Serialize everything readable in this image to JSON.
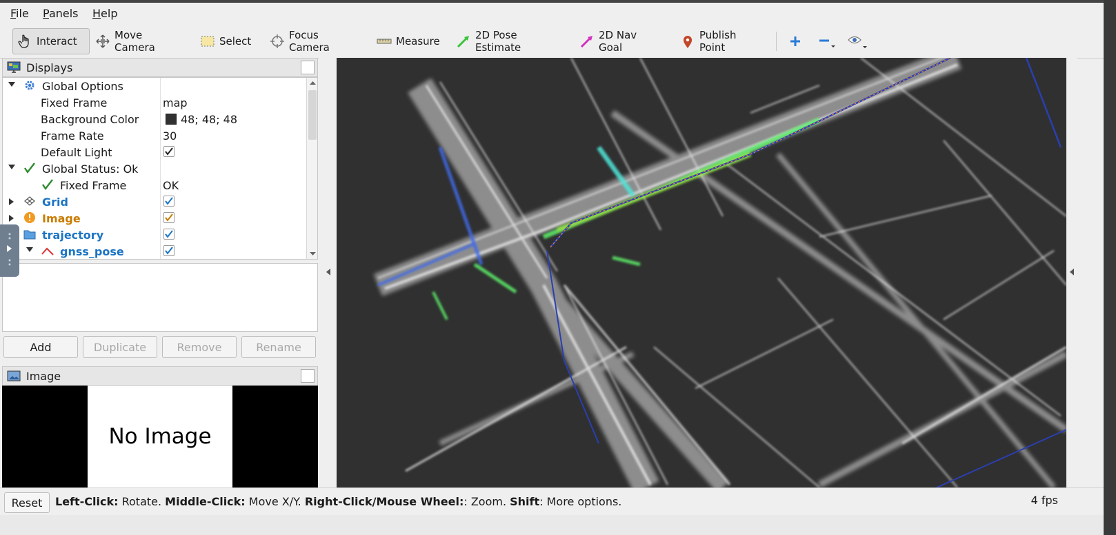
{
  "menu": [
    "File",
    "Panels",
    "Help"
  ],
  "toolbar": {
    "tools": [
      {
        "label": "Interact",
        "icon": "hand-pointer-icon",
        "active": true
      },
      {
        "label": "Move Camera",
        "icon": "move-camera-icon"
      },
      {
        "label": "Select",
        "icon": "select-box-icon"
      },
      {
        "label": "Focus Camera",
        "icon": "focus-crosshair-icon"
      },
      {
        "label": "Measure",
        "icon": "ruler-icon"
      },
      {
        "label": "2D Pose Estimate",
        "icon": "green-arrow-icon"
      },
      {
        "label": "2D Nav Goal",
        "icon": "magenta-arrow-icon"
      },
      {
        "label": "Publish Point",
        "icon": "map-pin-icon"
      }
    ],
    "extra_icons": [
      "plus-icon",
      "minus-icon",
      "eye-icon"
    ]
  },
  "displays_panel": {
    "title": "Displays",
    "tree": {
      "global_options": "Global Options",
      "fixed_frame_label": "Fixed Frame",
      "fixed_frame_value": "map",
      "bg_color_label": "Background Color",
      "bg_color_value": "48; 48; 48",
      "bg_color_swatch": "#303030",
      "frame_rate_label": "Frame Rate",
      "frame_rate_value": "30",
      "default_light_label": "Default Light",
      "default_light_checked": true,
      "global_status": "Global Status: Ok",
      "status_fixed_frame": "Fixed Frame",
      "status_fixed_frame_value": "OK",
      "grid": "Grid",
      "image": "Image",
      "trajectory": "trajectory",
      "gnss_pose": "gnss_pose"
    },
    "buttons": {
      "add": "Add",
      "duplicate": "Duplicate",
      "remove": "Remove",
      "rename": "Rename"
    }
  },
  "image_panel": {
    "title": "Image",
    "placeholder": "No Image"
  },
  "status_bar": {
    "reset": "Reset",
    "hint_parts": [
      {
        "text": "Left-Click:",
        "bold": true
      },
      {
        "text": " Rotate. ",
        "bold": false
      },
      {
        "text": "Middle-Click:",
        "bold": true
      },
      {
        "text": " Move X/Y. ",
        "bold": false
      },
      {
        "text": "Right-Click/Mouse Wheel:",
        "bold": true
      },
      {
        "text": ": Zoom. ",
        "bold": false
      },
      {
        "text": "Shift",
        "bold": true
      },
      {
        "text": ": More options.",
        "bold": false
      }
    ],
    "fps": "4 fps"
  },
  "colors": {
    "viewport_bg": "#303030",
    "accent_blue": "#1b74c4",
    "accent_orange": "#c87c00",
    "check_green": "#2e8b2e"
  }
}
